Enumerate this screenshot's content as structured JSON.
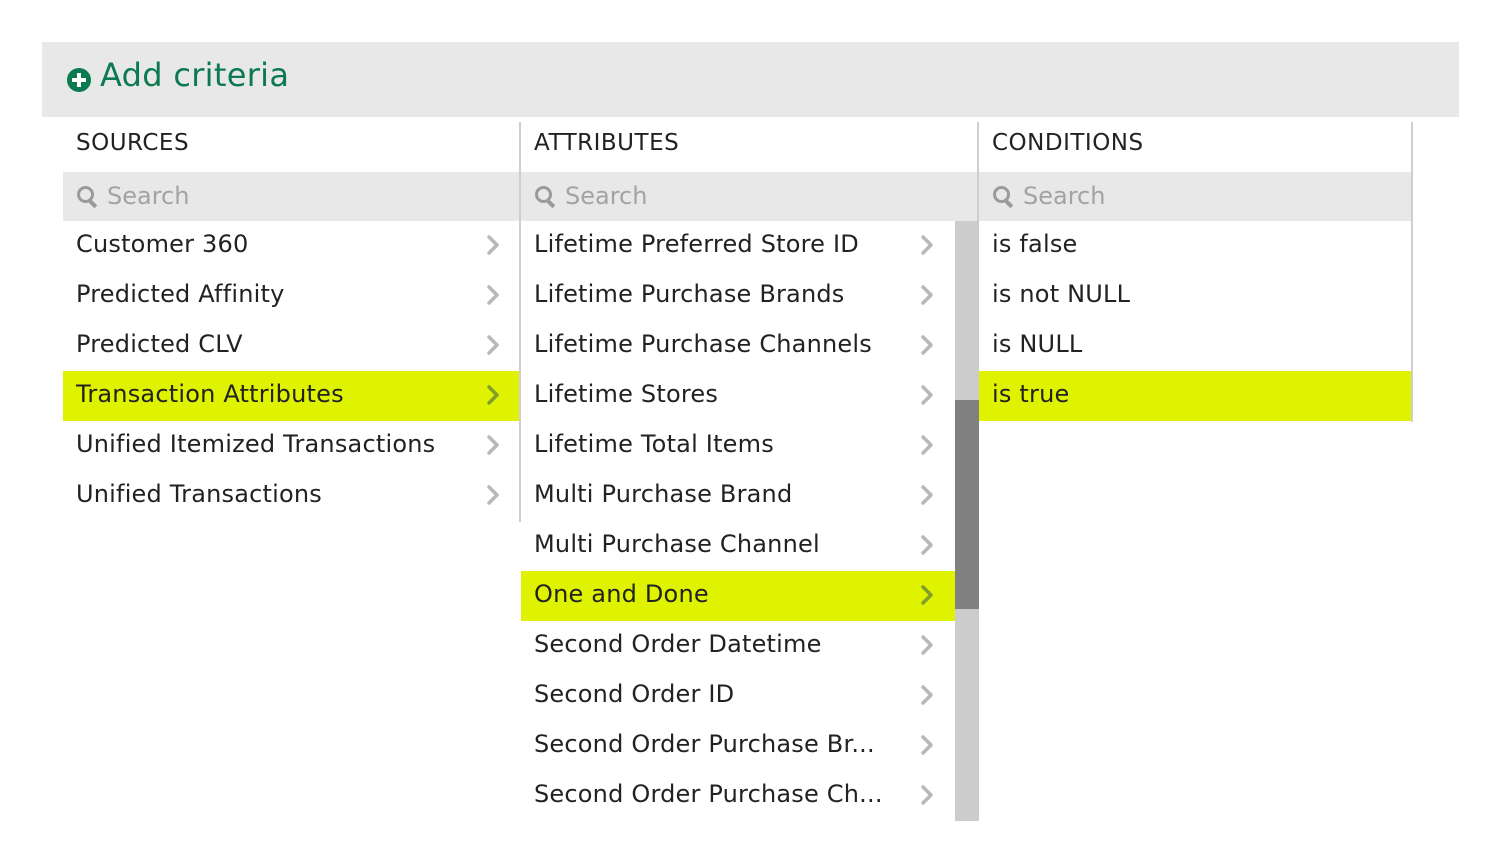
{
  "header": {
    "title": "Add criteria",
    "icon": "plus-circle-icon",
    "color": "#0b7a50"
  },
  "highlight_color": "#dff200",
  "columns": {
    "sources": {
      "title": "SOURCES",
      "search_placeholder": "Search",
      "items": [
        {
          "label": "Customer 360"
        },
        {
          "label": "Predicted Affinity"
        },
        {
          "label": "Predicted CLV"
        },
        {
          "label": "Transaction Attributes",
          "selected": true
        },
        {
          "label": "Unified Itemized Transactions"
        },
        {
          "label": "Unified Transactions"
        }
      ]
    },
    "attributes": {
      "title": "ATTRIBUTES",
      "search_placeholder": "Search",
      "items": [
        {
          "label": "Lifetime Preferred Store ID"
        },
        {
          "label": "Lifetime Purchase Brands"
        },
        {
          "label": "Lifetime Purchase Channels"
        },
        {
          "label": "Lifetime Stores"
        },
        {
          "label": "Lifetime Total Items"
        },
        {
          "label": "Multi Purchase Brand"
        },
        {
          "label": "Multi Purchase Channel"
        },
        {
          "label": "One and Done",
          "selected": true
        },
        {
          "label": "Second Order Datetime"
        },
        {
          "label": "Second Order ID"
        },
        {
          "label": "Second Order Purchase Br..."
        },
        {
          "label": "Second Order Purchase Ch..."
        }
      ],
      "scroll_position": 0.3
    },
    "conditions": {
      "title": "CONDITIONS",
      "search_placeholder": "Search",
      "items": [
        {
          "label": "is false"
        },
        {
          "label": "is not NULL"
        },
        {
          "label": "is NULL"
        },
        {
          "label": "is true",
          "selected": true
        }
      ]
    }
  }
}
